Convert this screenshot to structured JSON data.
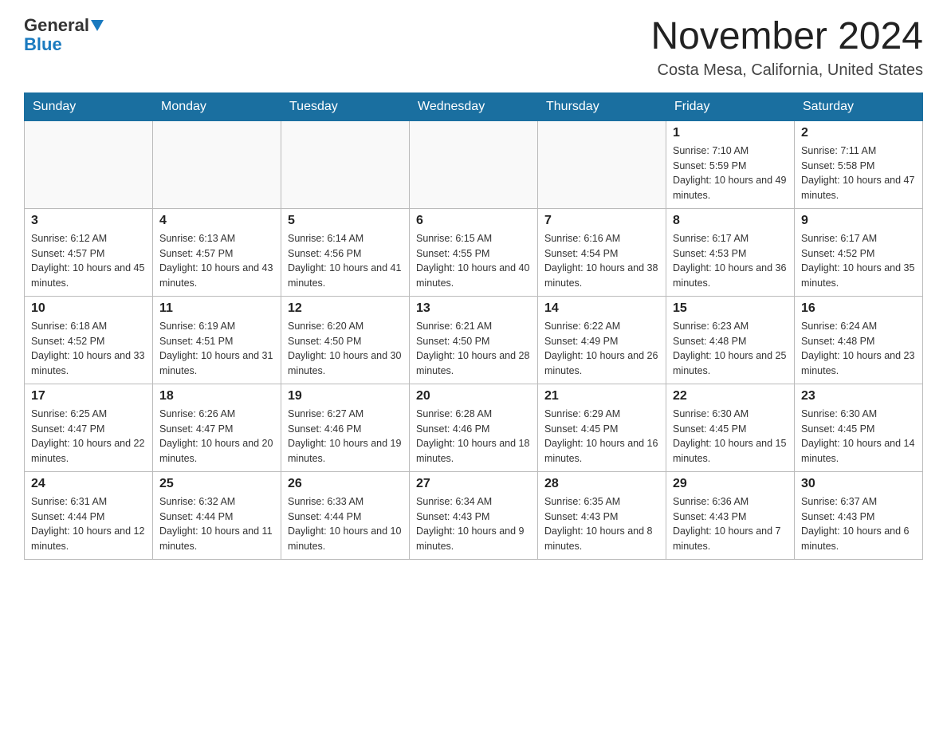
{
  "logo": {
    "general": "General",
    "blue": "Blue"
  },
  "title": "November 2024",
  "location": "Costa Mesa, California, United States",
  "days_of_week": [
    "Sunday",
    "Monday",
    "Tuesday",
    "Wednesday",
    "Thursday",
    "Friday",
    "Saturday"
  ],
  "weeks": [
    [
      {
        "day": "",
        "info": ""
      },
      {
        "day": "",
        "info": ""
      },
      {
        "day": "",
        "info": ""
      },
      {
        "day": "",
        "info": ""
      },
      {
        "day": "",
        "info": ""
      },
      {
        "day": "1",
        "info": "Sunrise: 7:10 AM\nSunset: 5:59 PM\nDaylight: 10 hours and 49 minutes."
      },
      {
        "day": "2",
        "info": "Sunrise: 7:11 AM\nSunset: 5:58 PM\nDaylight: 10 hours and 47 minutes."
      }
    ],
    [
      {
        "day": "3",
        "info": "Sunrise: 6:12 AM\nSunset: 4:57 PM\nDaylight: 10 hours and 45 minutes."
      },
      {
        "day": "4",
        "info": "Sunrise: 6:13 AM\nSunset: 4:57 PM\nDaylight: 10 hours and 43 minutes."
      },
      {
        "day": "5",
        "info": "Sunrise: 6:14 AM\nSunset: 4:56 PM\nDaylight: 10 hours and 41 minutes."
      },
      {
        "day": "6",
        "info": "Sunrise: 6:15 AM\nSunset: 4:55 PM\nDaylight: 10 hours and 40 minutes."
      },
      {
        "day": "7",
        "info": "Sunrise: 6:16 AM\nSunset: 4:54 PM\nDaylight: 10 hours and 38 minutes."
      },
      {
        "day": "8",
        "info": "Sunrise: 6:17 AM\nSunset: 4:53 PM\nDaylight: 10 hours and 36 minutes."
      },
      {
        "day": "9",
        "info": "Sunrise: 6:17 AM\nSunset: 4:52 PM\nDaylight: 10 hours and 35 minutes."
      }
    ],
    [
      {
        "day": "10",
        "info": "Sunrise: 6:18 AM\nSunset: 4:52 PM\nDaylight: 10 hours and 33 minutes."
      },
      {
        "day": "11",
        "info": "Sunrise: 6:19 AM\nSunset: 4:51 PM\nDaylight: 10 hours and 31 minutes."
      },
      {
        "day": "12",
        "info": "Sunrise: 6:20 AM\nSunset: 4:50 PM\nDaylight: 10 hours and 30 minutes."
      },
      {
        "day": "13",
        "info": "Sunrise: 6:21 AM\nSunset: 4:50 PM\nDaylight: 10 hours and 28 minutes."
      },
      {
        "day": "14",
        "info": "Sunrise: 6:22 AM\nSunset: 4:49 PM\nDaylight: 10 hours and 26 minutes."
      },
      {
        "day": "15",
        "info": "Sunrise: 6:23 AM\nSunset: 4:48 PM\nDaylight: 10 hours and 25 minutes."
      },
      {
        "day": "16",
        "info": "Sunrise: 6:24 AM\nSunset: 4:48 PM\nDaylight: 10 hours and 23 minutes."
      }
    ],
    [
      {
        "day": "17",
        "info": "Sunrise: 6:25 AM\nSunset: 4:47 PM\nDaylight: 10 hours and 22 minutes."
      },
      {
        "day": "18",
        "info": "Sunrise: 6:26 AM\nSunset: 4:47 PM\nDaylight: 10 hours and 20 minutes."
      },
      {
        "day": "19",
        "info": "Sunrise: 6:27 AM\nSunset: 4:46 PM\nDaylight: 10 hours and 19 minutes."
      },
      {
        "day": "20",
        "info": "Sunrise: 6:28 AM\nSunset: 4:46 PM\nDaylight: 10 hours and 18 minutes."
      },
      {
        "day": "21",
        "info": "Sunrise: 6:29 AM\nSunset: 4:45 PM\nDaylight: 10 hours and 16 minutes."
      },
      {
        "day": "22",
        "info": "Sunrise: 6:30 AM\nSunset: 4:45 PM\nDaylight: 10 hours and 15 minutes."
      },
      {
        "day": "23",
        "info": "Sunrise: 6:30 AM\nSunset: 4:45 PM\nDaylight: 10 hours and 14 minutes."
      }
    ],
    [
      {
        "day": "24",
        "info": "Sunrise: 6:31 AM\nSunset: 4:44 PM\nDaylight: 10 hours and 12 minutes."
      },
      {
        "day": "25",
        "info": "Sunrise: 6:32 AM\nSunset: 4:44 PM\nDaylight: 10 hours and 11 minutes."
      },
      {
        "day": "26",
        "info": "Sunrise: 6:33 AM\nSunset: 4:44 PM\nDaylight: 10 hours and 10 minutes."
      },
      {
        "day": "27",
        "info": "Sunrise: 6:34 AM\nSunset: 4:43 PM\nDaylight: 10 hours and 9 minutes."
      },
      {
        "day": "28",
        "info": "Sunrise: 6:35 AM\nSunset: 4:43 PM\nDaylight: 10 hours and 8 minutes."
      },
      {
        "day": "29",
        "info": "Sunrise: 6:36 AM\nSunset: 4:43 PM\nDaylight: 10 hours and 7 minutes."
      },
      {
        "day": "30",
        "info": "Sunrise: 6:37 AM\nSunset: 4:43 PM\nDaylight: 10 hours and 6 minutes."
      }
    ]
  ]
}
